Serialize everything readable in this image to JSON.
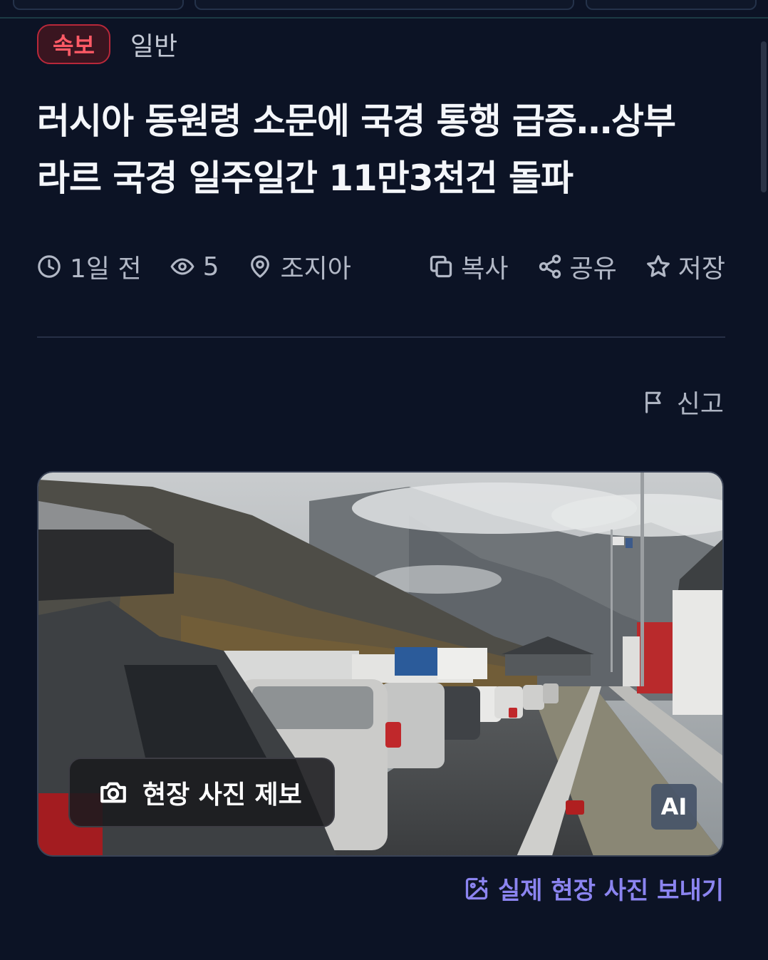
{
  "colors": {
    "background": "#0c1325",
    "breaking_tag": "#ff5a66",
    "link": "#8b84f0"
  },
  "tags": {
    "breaking": "속보",
    "category": "일반"
  },
  "headline_lines": [
    "러시아 동원령 소문에 국경 통행 급증…상부",
    "라르 국경 일주일간 11만3천건 돌파"
  ],
  "meta": {
    "time": "1일 전",
    "views": "5",
    "location": "조지아"
  },
  "actions": {
    "copy": "복사",
    "share": "공유",
    "save": "저장"
  },
  "report_label": "신고",
  "photo": {
    "submit_label": "현장 사진 제보",
    "ai_badge": "AI"
  },
  "send_real_photo": "실제 현장 사진 보내기"
}
